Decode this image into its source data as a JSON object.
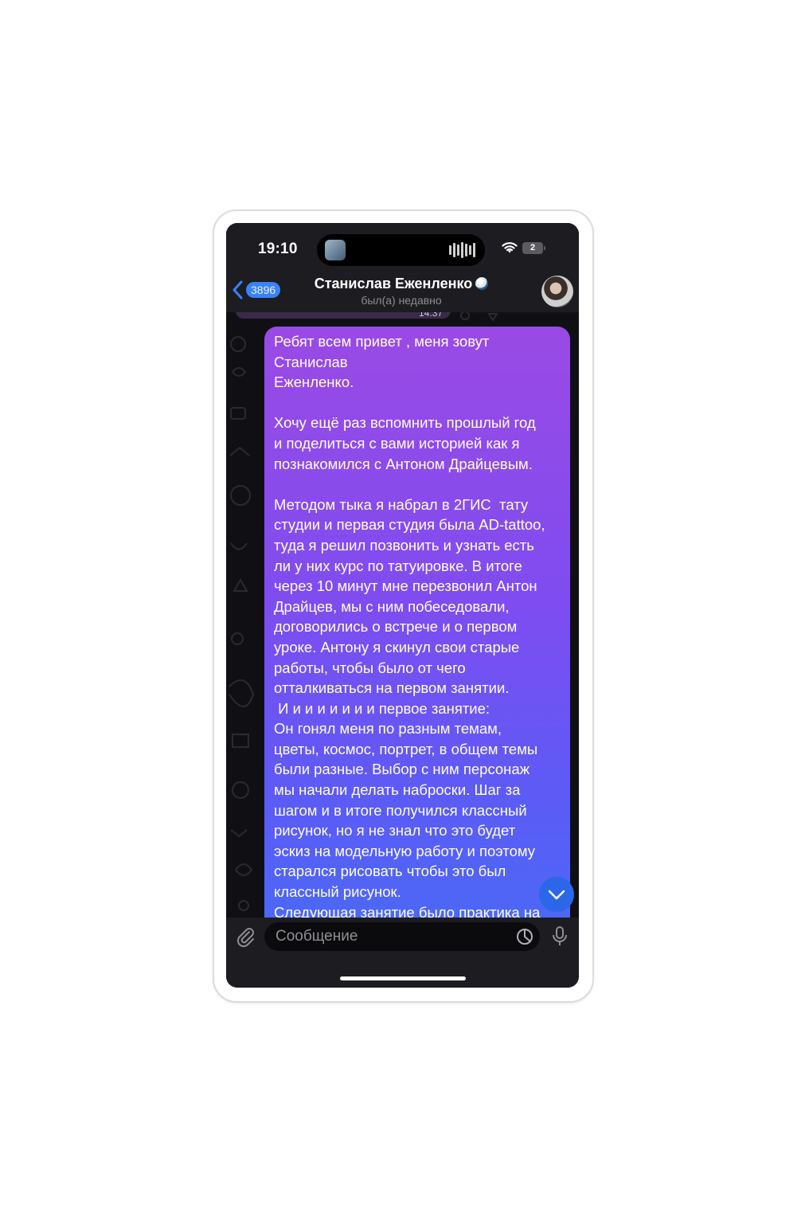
{
  "status_bar": {
    "time": "19:10",
    "battery": "2"
  },
  "header": {
    "back_count": "3896",
    "title": "Станислав Еженленко",
    "subtitle": "был(а) недавно",
    "icons": [
      "back-chevron-icon",
      "emoji-status-icon",
      "avatar"
    ]
  },
  "chat": {
    "timestamp": "14:37",
    "message": "Ребят всем привет , меня зовут\nСтанислав\nЕженленко.\n\nХочу ещё раз вспомнить прошлый год\nи поделиться с вами историей как я\nпознакомился с Антоном Драйцевым.\n\nМетодом тыка я набрал в 2ГИС  тату\nстудии и первая студия была AD-tattoo,\nтуда я решил позвонить и узнать есть\nли у них курс по татуировке. В итоге\nчерез 10 минут мне перезвонил Антон\nДрайцев, мы с ним побеседовали,\nдоговорились о встрече и о первом\nуроке. Антону я скинул свои старые\nработы, чтобы было от чего\nотталкиваться на первом занятии.\n И и и и и и и и первое занятие:\nОн гонял меня по разным темам,\nцветы, космос, портрет, в общем темы\nбыли разные. Выбор с ним персонаж\nмы начали делать наброски. Шаг за\nшагом и в итоге получился классный\nрисунок, но я не знал что это будет\nэскиз на модельную работу и поэтому\nстарался рисовать чтобы это был\nклассный рисунок.\nСледующая занятие было практика на"
  },
  "input": {
    "placeholder": "Сообщение"
  },
  "colors": {
    "bubble_top": "#9a4ae4",
    "bubble_bottom": "#4b69f5",
    "accent": "#3a82f7",
    "background": "#17171c"
  }
}
